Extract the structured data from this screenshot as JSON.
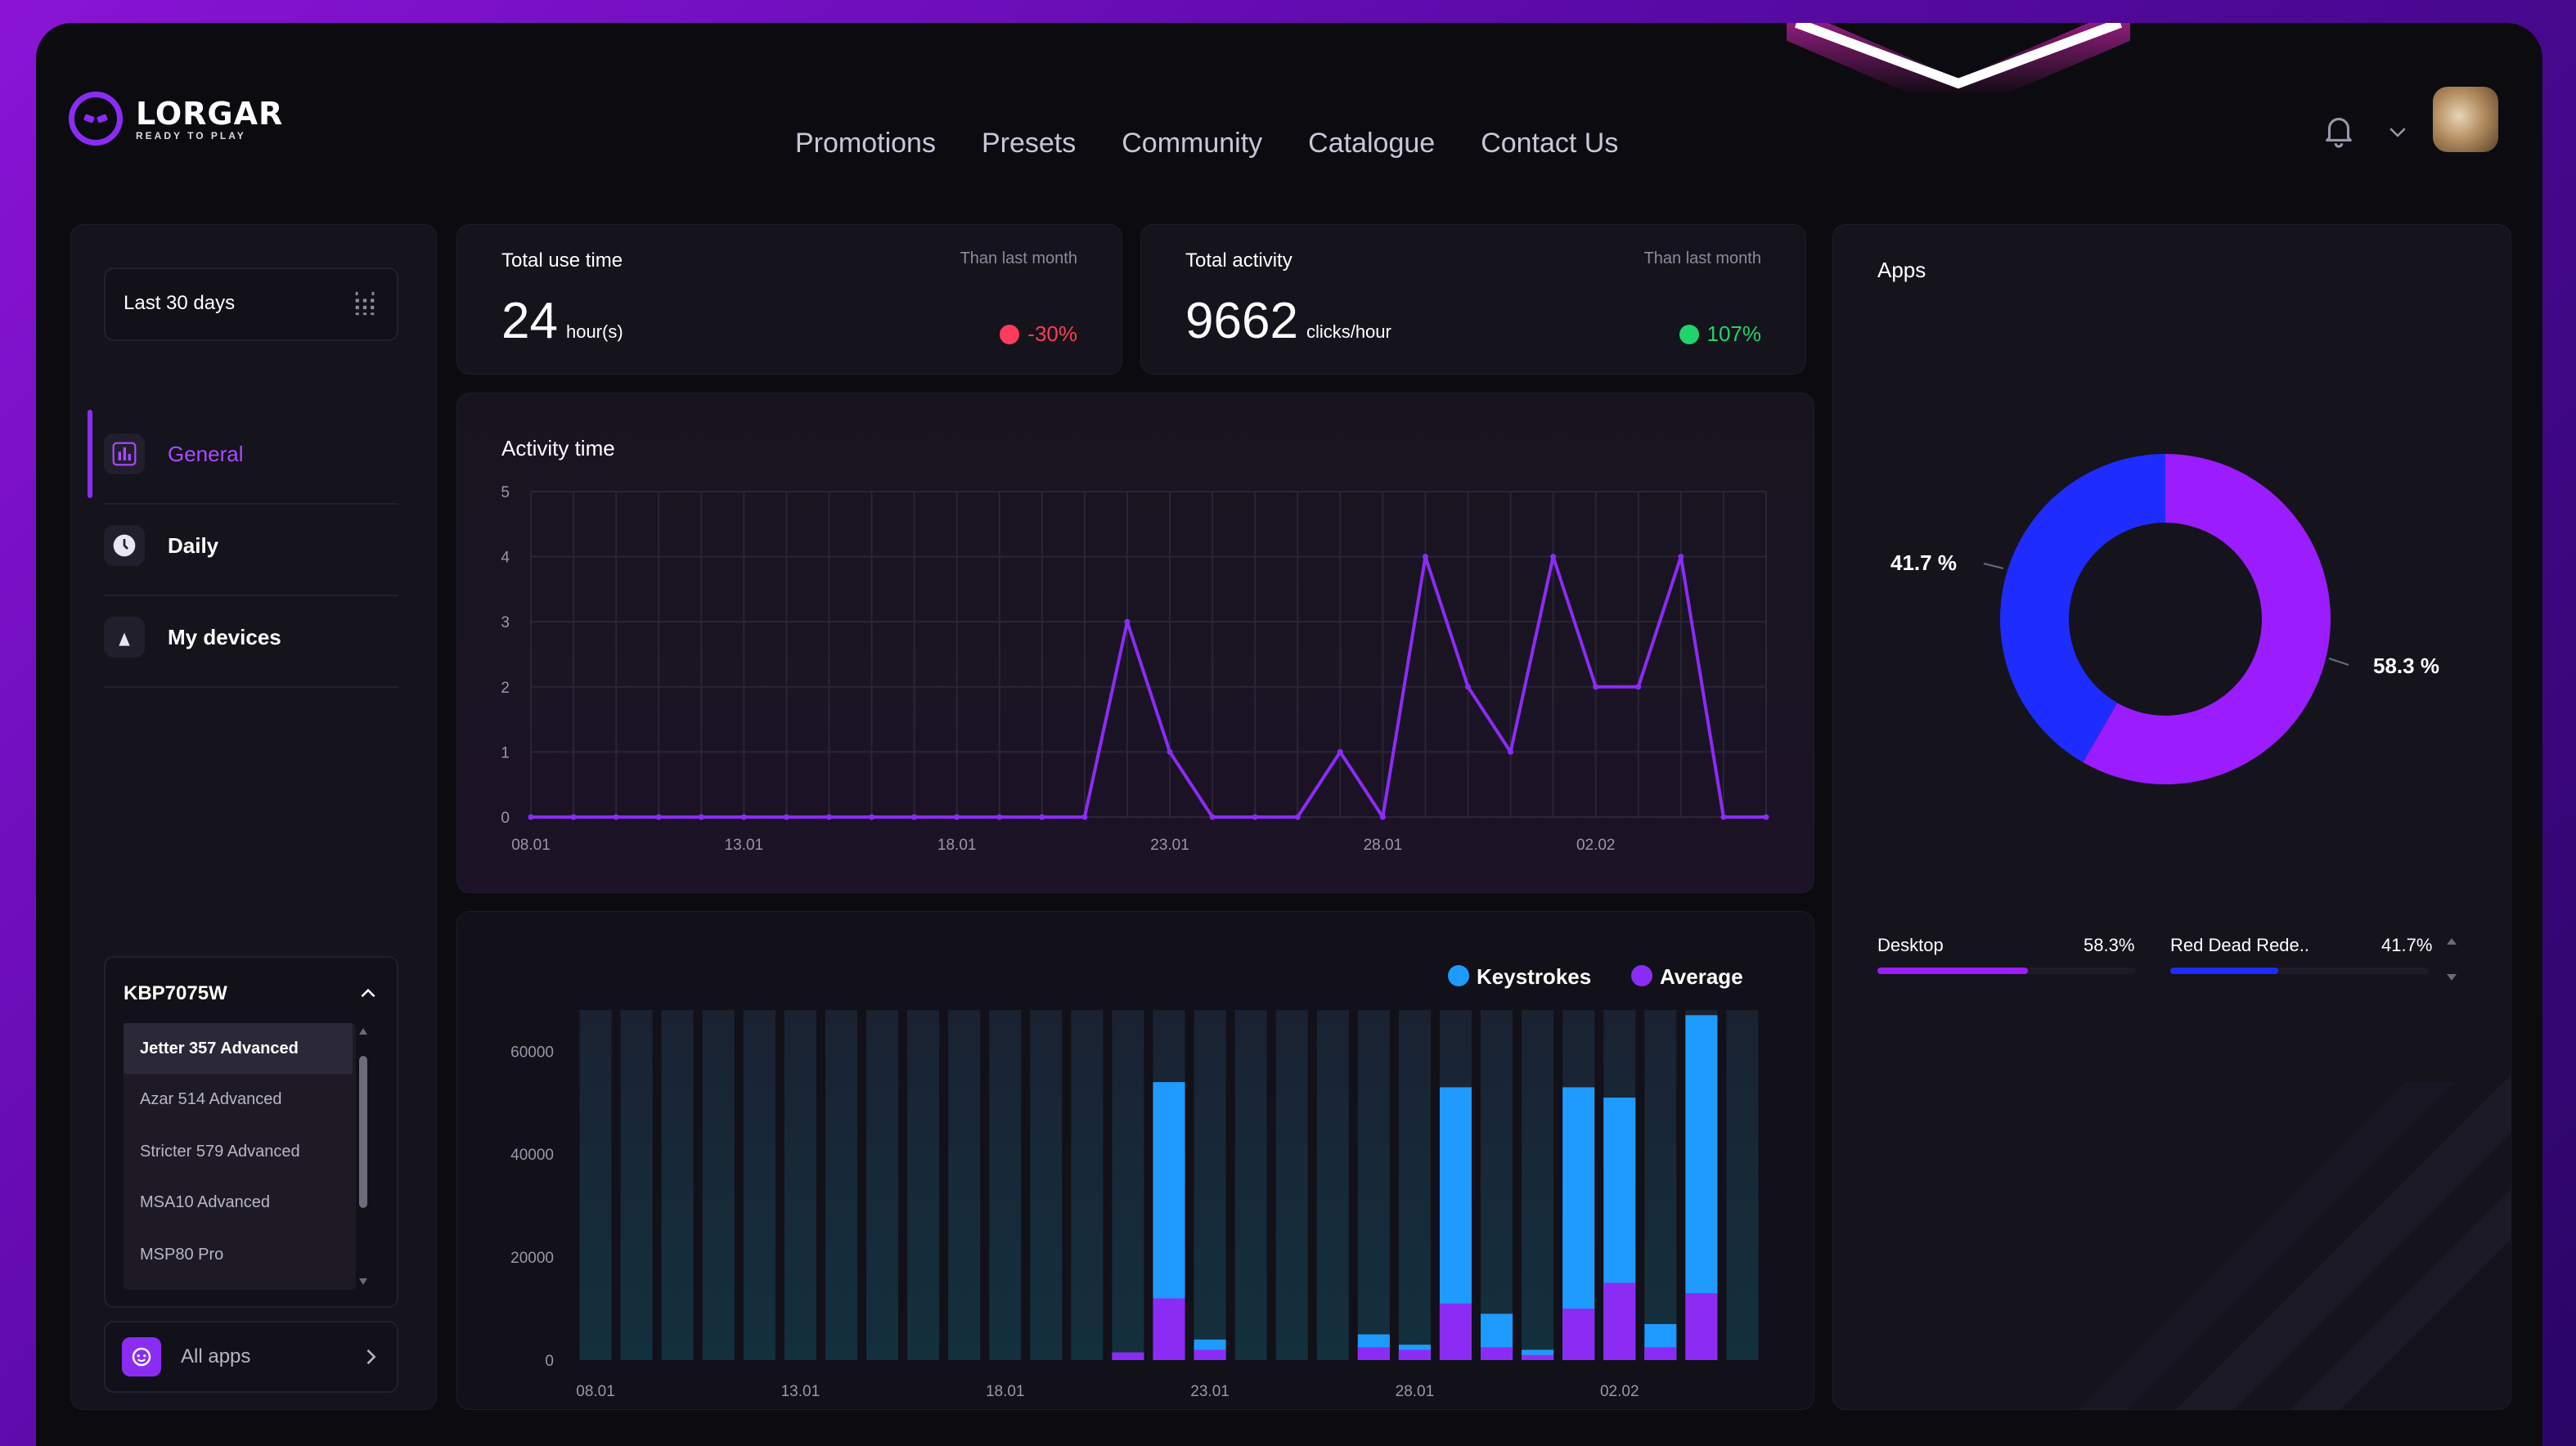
{
  "brand": {
    "name": "LORGAR",
    "tagline": "READY TO PLAY"
  },
  "nav": [
    "Promotions",
    "Presets",
    "Community",
    "Catalogue",
    "Contact Us"
  ],
  "icons": {
    "notifications": "bell-icon",
    "account_menu": "chevron-down-icon",
    "date_picker": "calendar-icon"
  },
  "sidebar": {
    "date_range": "Last 30 days",
    "menu": [
      {
        "label": "General",
        "icon": "bar-chart-icon",
        "active": true
      },
      {
        "label": "Daily",
        "icon": "clock-icon",
        "active": false
      },
      {
        "label": "My devices",
        "icon": "mouse-icon",
        "active": false
      }
    ],
    "device_selector": {
      "selected": "KBP7075W",
      "options": [
        "Jetter 357 Advanced",
        "Azar 514 Advanced",
        "Stricter 579 Advanced",
        "MSA10 Advanced",
        "MSP80 Pro"
      ]
    },
    "all_apps": "All apps"
  },
  "stats": [
    {
      "title": "Total use time",
      "compare": "Than last month",
      "value": "24",
      "unit": "hour(s)",
      "delta": "-30%",
      "delta_color": "#ff3b5c"
    },
    {
      "title": "Total activity",
      "compare": "Than last month",
      "value": "9662",
      "unit": "clicks/hour",
      "delta": "107%",
      "delta_color": "#20d46b"
    }
  ],
  "colors": {
    "accent": "#8b2cf5",
    "blue": "#1f6bff",
    "cyan": "#1e9bff",
    "negative": "#ff3b5c",
    "positive": "#20d46b"
  },
  "chart_data": [
    {
      "type": "line",
      "title": "Activity time",
      "x": [
        "08.01",
        "09.01",
        "10.01",
        "11.01",
        "12.01",
        "13.01",
        "14.01",
        "15.01",
        "16.01",
        "17.01",
        "18.01",
        "19.01",
        "20.01",
        "21.01",
        "22.01",
        "23.01",
        "24.01",
        "25.01",
        "26.01",
        "27.01",
        "28.01",
        "29.01",
        "30.01",
        "31.01",
        "01.02",
        "02.02",
        "03.02",
        "04.02",
        "05.02",
        "06.02"
      ],
      "x_tick_labels": [
        "08.01",
        "13.01",
        "18.01",
        "23.01",
        "28.01",
        "02.02"
      ],
      "series": [
        {
          "values": [
            0,
            0,
            0,
            0,
            0,
            0,
            0,
            0,
            0,
            0,
            0,
            0,
            0,
            0,
            3,
            1,
            0,
            0,
            0,
            1,
            0,
            4,
            2,
            1,
            4,
            2,
            2,
            4,
            0,
            0
          ]
        }
      ],
      "ylim": [
        0,
        5
      ],
      "y_ticks": [
        0,
        1,
        2,
        3,
        4,
        5
      ],
      "grid": true
    },
    {
      "type": "bar",
      "x": [
        "08.01",
        "09.01",
        "10.01",
        "11.01",
        "12.01",
        "13.01",
        "14.01",
        "15.01",
        "16.01",
        "17.01",
        "18.01",
        "19.01",
        "20.01",
        "21.01",
        "22.01",
        "23.01",
        "24.01",
        "25.01",
        "26.01",
        "27.01",
        "28.01",
        "29.01",
        "30.01",
        "31.01",
        "01.02",
        "02.02",
        "03.02",
        "04.02",
        "05.02"
      ],
      "x_tick_labels": [
        "08.01",
        "13.01",
        "18.01",
        "23.01",
        "28.01",
        "02.02"
      ],
      "series": [
        {
          "name": "Keystrokes",
          "color": "#1e9bff",
          "values": [
            0,
            0,
            0,
            0,
            0,
            0,
            0,
            0,
            0,
            0,
            0,
            0,
            0,
            0,
            54000,
            4000,
            0,
            0,
            0,
            5000,
            3000,
            53000,
            9000,
            2000,
            53000,
            51000,
            7000,
            67000,
            0
          ]
        },
        {
          "name": "Average",
          "color": "#8b2cf5",
          "values": [
            0,
            0,
            0,
            0,
            0,
            0,
            0,
            0,
            0,
            0,
            0,
            0,
            0,
            1500,
            12000,
            2000,
            0,
            0,
            0,
            2500,
            2000,
            11000,
            2500,
            1000,
            10000,
            15000,
            2500,
            13000,
            0
          ]
        }
      ],
      "ylim": [
        0,
        68000
      ],
      "y_ticks": [
        0,
        20000,
        40000,
        60000
      ],
      "stacked": false,
      "legend": "top-right"
    },
    {
      "type": "pie",
      "title": "Apps",
      "donut": true,
      "labels": [
        "Desktop",
        "Red Dead Rede.."
      ],
      "values": [
        58.3,
        41.7
      ],
      "value_labels": [
        "58.3 %",
        "41.7 %"
      ],
      "colors": [
        "#9b1cff",
        "#1f2cff"
      ]
    }
  ],
  "apps_legend": [
    {
      "name": "Desktop",
      "percent": "58.3%",
      "value": 0.583,
      "color": "#9b1cff"
    },
    {
      "name": "Red Dead Rede..",
      "percent": "41.7%",
      "value": 0.417,
      "color": "#1f2cff"
    }
  ]
}
